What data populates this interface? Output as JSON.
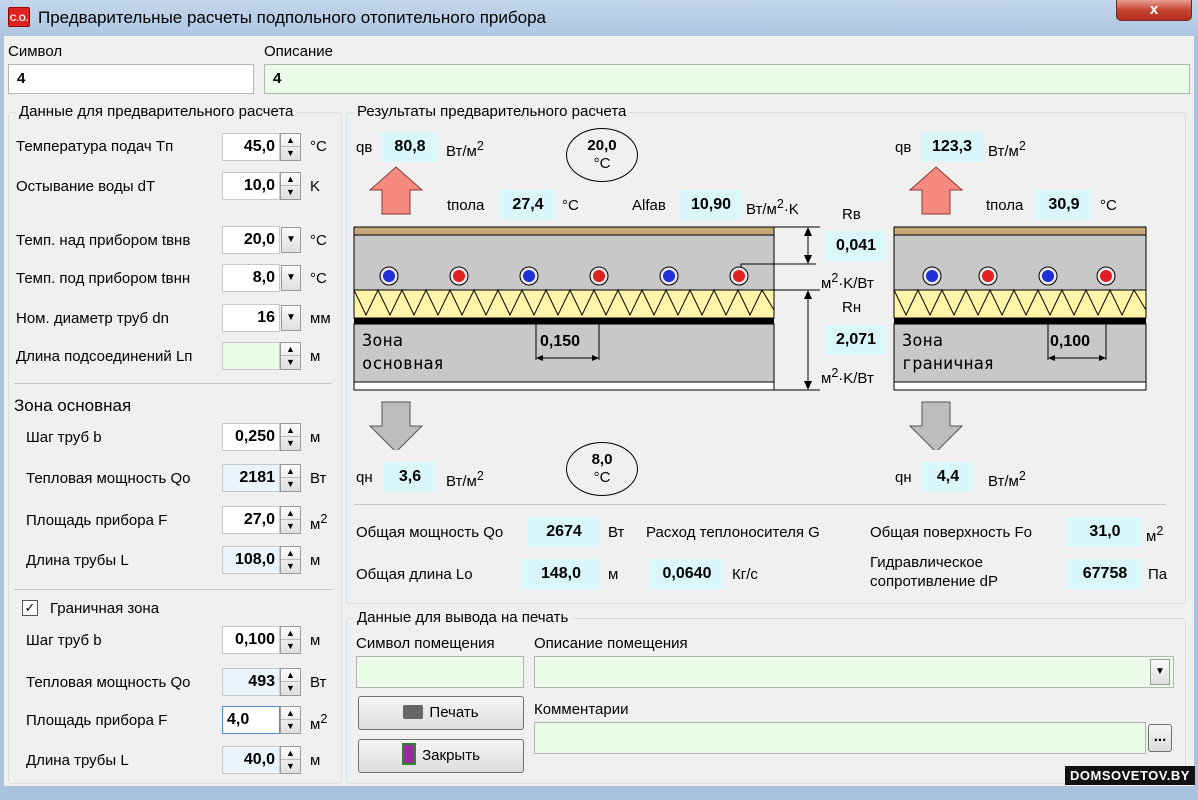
{
  "window": {
    "icon": "C.O.",
    "title": "Предварительные расчеты подпольного отопительного прибора",
    "close": "x"
  },
  "header": {
    "symbol_label": "Символ",
    "symbol_value": "4",
    "description_label": "Описание",
    "description_value": "4"
  },
  "left": {
    "group_title": "Данные для предварительного расчета",
    "supply_temp": {
      "label": "Температура подач  Tп",
      "value": "45,0",
      "unit": "°C"
    },
    "cooling": {
      "label": "Остывание воды dT",
      "value": "10,0",
      "unit": "K"
    },
    "temp_above": {
      "label": "Темп. над прибором tвнв",
      "value": "20,0",
      "unit": "°C"
    },
    "temp_below": {
      "label": "Темп. под прибором tвнн",
      "value": "8,0",
      "unit": "°C"
    },
    "pipe_diam": {
      "label": "Ном. диаметр труб dn",
      "value": "16",
      "unit": "мм"
    },
    "conn_length": {
      "label": "Длина подсоединений Lп",
      "value": "",
      "unit": "м"
    },
    "main_zone": {
      "title": "Зона основная",
      "pitch": {
        "label": "Шаг труб b",
        "value": "0,250",
        "unit": "м"
      },
      "power": {
        "label": "Тепловая мощность Qo",
        "value": "2181",
        "unit": "Вт"
      },
      "area": {
        "label": "Площадь прибора F",
        "value": "27,0",
        "unit": "м",
        "sup": "2"
      },
      "length": {
        "label": "Длина трубы L",
        "value": "108,0",
        "unit": "м"
      }
    },
    "edge_zone": {
      "title": "Граничная зона",
      "checked": "✓",
      "pitch": {
        "label": "Шаг труб b",
        "value": "0,100",
        "unit": "м"
      },
      "power": {
        "label": "Тепловая мощность Qo",
        "value": "493",
        "unit": "Вт"
      },
      "area": {
        "label": "Площадь прибора F",
        "value": "4,0",
        "unit": "м",
        "sup": "2"
      },
      "length": {
        "label": "Длина трубы L",
        "value": "40,0",
        "unit": "м"
      }
    }
  },
  "results": {
    "group_title": "Результаты предварительного расчета",
    "main": {
      "qv_label": "qв",
      "qv_value": "80,8",
      "qv_unit": "Вт/м",
      "qv_sup": "2",
      "tfloor_label": "tпола",
      "tfloor_value": "27,4",
      "tfloor_unit": "°C",
      "alfa_label": "Alfaв",
      "alfa_value": "10,90",
      "alfa_unit": "Вт/м",
      "alfa_sup": "2",
      "alfa_unit2": "·K",
      "qn_label": "qн",
      "qn_value": "3,6",
      "qn_unit": "Вт/м",
      "qn_sup": "2",
      "zone_line1": "Зона",
      "zone_line2": "основная",
      "spacing": "0,150"
    },
    "edge": {
      "qv_label": "qв",
      "qv_value": "123,3",
      "qv_unit": "Вт/м",
      "qv_sup": "2",
      "tfloor_label": "tпола",
      "tfloor_value": "30,9",
      "tfloor_unit": "°C",
      "qn_label": "qн",
      "qn_value": "4,4",
      "qn_unit": "Вт/м",
      "qn_sup": "2",
      "zone_line1": "Зона",
      "zone_line2": "граничная",
      "spacing": "0,100"
    },
    "top_oval": {
      "value": "20,0",
      "unit": "°C"
    },
    "bottom_oval": {
      "value": "8,0",
      "unit": "°C"
    },
    "rv": {
      "label": "Rв",
      "value": "0,041",
      "unit": "м",
      "sup": "2",
      "unit2": "·K/Вт"
    },
    "rn": {
      "label": "Rн",
      "value": "2,071",
      "unit": "м",
      "sup": "2",
      "unit2": "·K/Вт"
    },
    "summary": {
      "total_power_label": "Общая мощность Qo",
      "total_power_value": "2674",
      "total_power_unit": "Вт",
      "flow_label": "Расход теплоносителя G",
      "flow_value": "0,0640",
      "flow_unit": "Кг/с",
      "surface_label": "Общая поверхность Fo",
      "surface_value": "31,0",
      "surface_unit": "м",
      "surface_sup": "2",
      "length_label": "Общая длина Lo",
      "length_value": "148,0",
      "length_unit": "м",
      "dp_label1": "Гидравлическое",
      "dp_label2": "сопротивление dP",
      "dp_value": "67758",
      "dp_unit": "Па"
    }
  },
  "print": {
    "group_title": "Данные для вывода на печать",
    "room_symbol_label": "Символ помещения",
    "room_symbol_value": "",
    "room_desc_label": "Описание помещения",
    "room_desc_value": "",
    "comments_label": "Комментарии",
    "comments_value": "",
    "print_button": "Печать",
    "close_button": "Закрыть",
    "ellipsis": "..."
  },
  "watermark": "DOMSOVETOV.BY",
  "colors": {
    "hot_pipe": "#e02020",
    "cold_pipe": "#2030d8",
    "insulation": "#fff4a8",
    "result_bg": "#d9f6fb",
    "arrow_up": "#f48a80",
    "arrow_down": "#bdbdbd"
  }
}
